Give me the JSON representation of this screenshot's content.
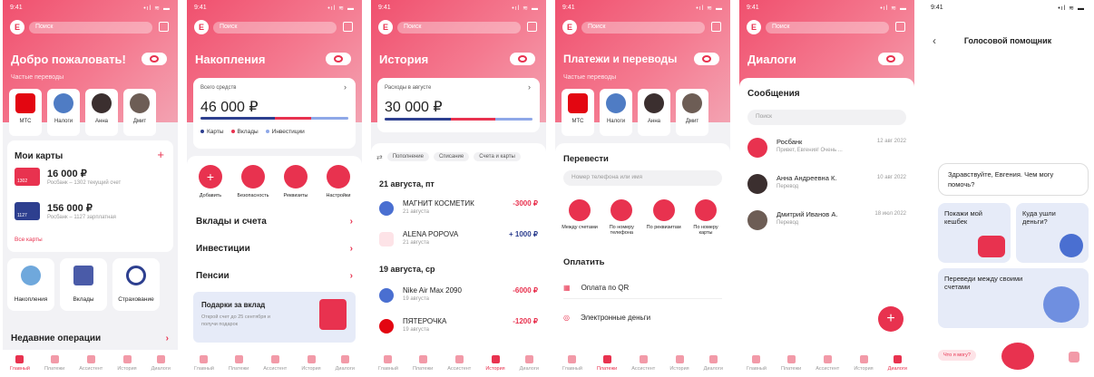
{
  "status": {
    "time": "9:41",
    "signal": "•ıl ≋ ▬"
  },
  "common": {
    "avatar": "E",
    "search": "Поиск"
  },
  "tabs": [
    "Главный",
    "Платежи",
    "Ассистент",
    "История",
    "Диалоги"
  ],
  "s1": {
    "title": "Добро пожаловать!",
    "frequent": "Частые переводы",
    "tiles": [
      "МТС",
      "Налоги",
      "Анна",
      "Дмит"
    ],
    "cards_title": "Мои карты",
    "cards": [
      {
        "num": "1302",
        "amount": "16 000 ₽",
        "desc": "Росбанк – 1302 текущий счет"
      },
      {
        "num": "1127",
        "amount": "156 000 ₽",
        "desc": "Росбанк – 1127 зарплатная"
      }
    ],
    "all_cards": "Все карты",
    "products": [
      "Накопления",
      "Вклады",
      "Страхование"
    ],
    "recent": "Недавние операции"
  },
  "s2": {
    "title": "Накопления",
    "total_label": "Всего средств",
    "total": "46 000 ₽",
    "legend": [
      "Карты",
      "Вклады",
      "Инвестиции"
    ],
    "actions": [
      "Добавить",
      "Безопасность",
      "Реквизиты",
      "Настройки"
    ],
    "sections": [
      "Вклады и счета",
      "Инвестиции",
      "Пенсии"
    ],
    "promo_title": "Подарки за вклад",
    "promo_text": "Открой счет до 25 сентября и получи подарок"
  },
  "s3": {
    "title": "История",
    "expense_label": "Расходы в августе",
    "expense": "30 000 ₽",
    "chips": [
      "Пополнение",
      "Списание",
      "Счета и карты"
    ],
    "groups": [
      {
        "date": "21 августа, пт",
        "items": [
          {
            "name": "МАГНИТ КОСМЕТИК",
            "date": "21 августа",
            "amount": "-3000 ₽"
          },
          {
            "name": "ALENA POPOVA",
            "date": "21 августа",
            "amount": "+ 1000 ₽"
          }
        ]
      },
      {
        "date": "19 августа, ср",
        "items": [
          {
            "name": "Nike Air Max 2090",
            "date": "19 августа",
            "amount": "-6000 ₽"
          },
          {
            "name": "ПЯТЕРОЧКА",
            "date": "19 августа",
            "amount": "-1200 ₽"
          }
        ]
      }
    ]
  },
  "s4": {
    "title": "Платежи и переводы",
    "frequent": "Частые переводы",
    "tiles": [
      "МТС",
      "Налоги",
      "Анна",
      "Дмит"
    ],
    "transfer": "Перевести",
    "phone_placeholder": "Номер телефона или имя",
    "methods": [
      "Между счетами",
      "По номеру телефона",
      "По реквизитам",
      "По номеру карты"
    ],
    "pay": "Оплатить",
    "pay_items": [
      "Оплата по QR",
      "Электронные деньги"
    ]
  },
  "s5": {
    "title": "Диалоги",
    "messages": "Сообщения",
    "search": "Поиск",
    "dialogs": [
      {
        "name": "Росбанк",
        "preview": "Привет, Евгения! Очень ...",
        "date": "12 авг 2022"
      },
      {
        "name": "Анна Андреевна К.",
        "preview": "Перевод",
        "date": "10 авг 2022"
      },
      {
        "name": "Дмитрий Иванов А.",
        "preview": "Перевод",
        "date": "18 июл 2022"
      }
    ]
  },
  "s6": {
    "title": "Голосовой помощник",
    "greeting": "Здравствуйте, Евгения. Чем могу помочь?",
    "cards": [
      "Покажи мой кешбек",
      "Куда ушли деньги?",
      "Переведи между своими счетами"
    ],
    "hint": "Что я могу?"
  },
  "colors": {
    "accent": "#e8324f",
    "header": "#f0506e"
  }
}
